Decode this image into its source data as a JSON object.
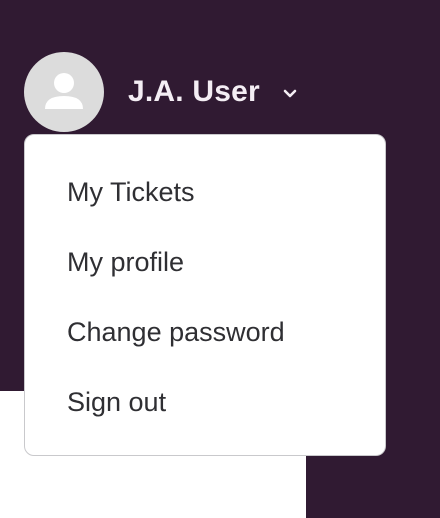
{
  "header": {
    "user_name": "J.A. User",
    "avatar_icon": "user-silhouette-icon",
    "toggle_icon": "chevron-down-icon"
  },
  "dropdown": {
    "items": [
      {
        "label": "My Tickets"
      },
      {
        "label": "My profile"
      },
      {
        "label": "Change password"
      },
      {
        "label": "Sign out"
      }
    ]
  },
  "colors": {
    "header_background": "#301a32",
    "avatar_background": "#dcdcdc",
    "menu_text": "#2f2f33",
    "menu_border": "#c9c9cc"
  }
}
